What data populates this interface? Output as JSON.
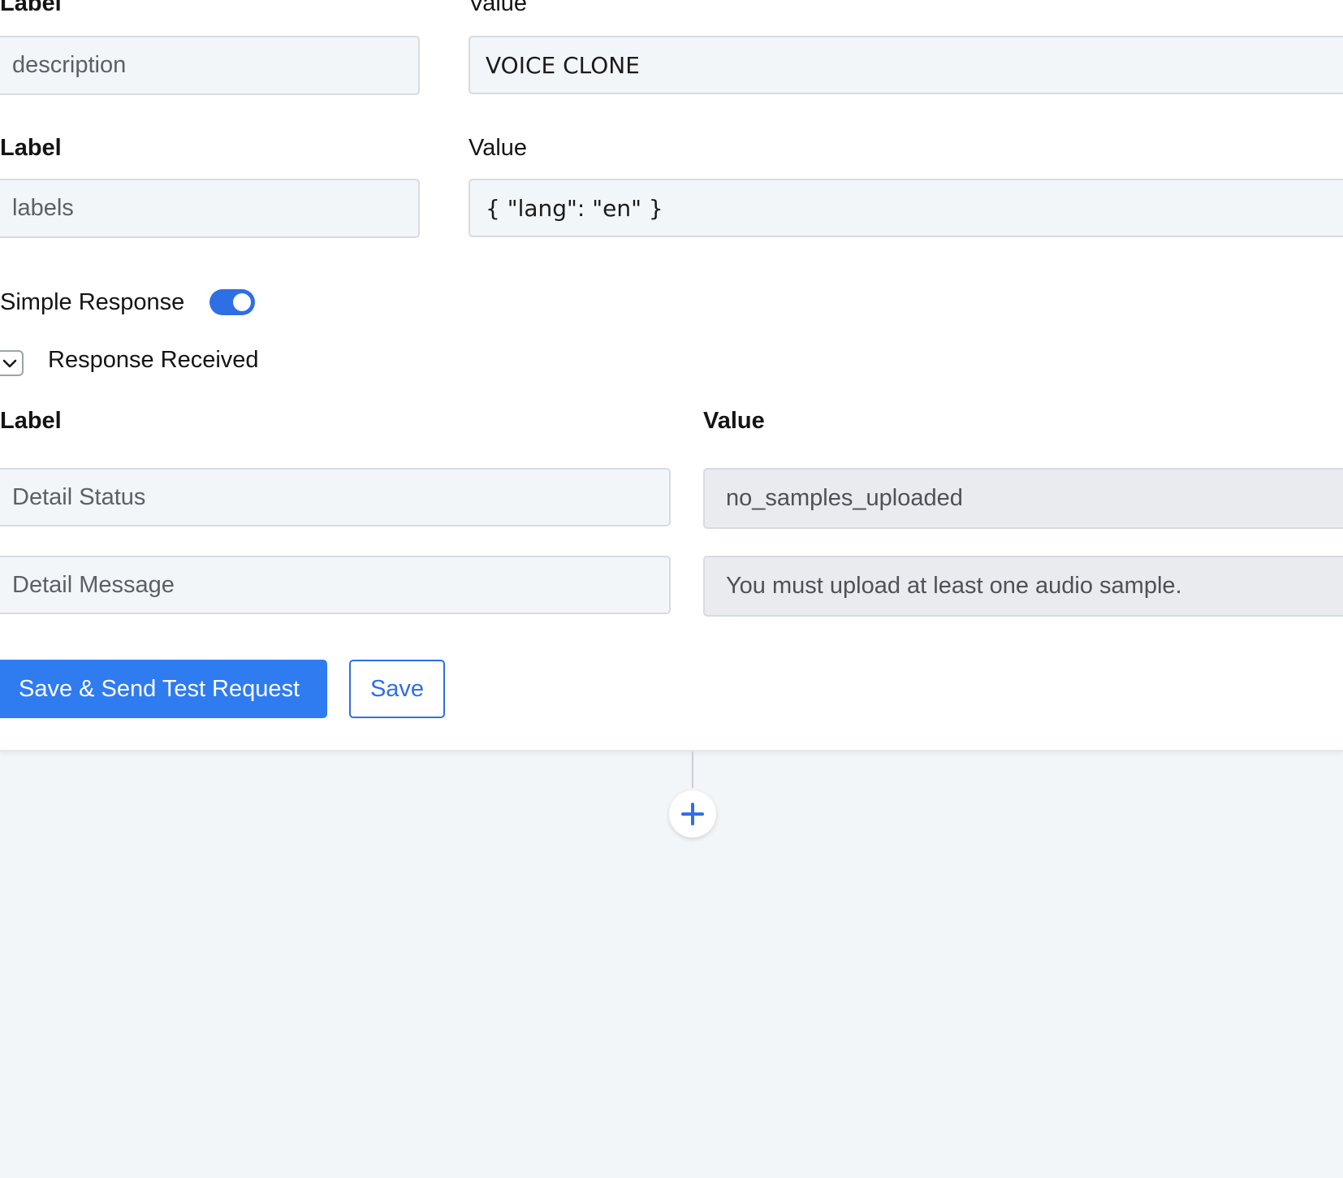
{
  "rows": [
    {
      "label_heading": "Label",
      "value_heading": "Value",
      "label_field": "description",
      "value_field": "VOICE CLONE"
    },
    {
      "label_heading": "Label",
      "value_heading": "Value",
      "label_field": "labels",
      "value_field": "{ \"lang\": \"en\" }"
    }
  ],
  "simple_response": {
    "label": "Simple Response",
    "enabled": true
  },
  "response_received": {
    "label": "Response Received",
    "label_heading": "Label",
    "value_heading": "Value",
    "items": [
      {
        "label": "Detail Status",
        "value": "no_samples_uploaded"
      },
      {
        "label": "Detail Message",
        "value": "You must upload at least one audio sample."
      }
    ]
  },
  "actions": {
    "save_and_send": "Save & Send Test Request",
    "save": "Save"
  },
  "icons": {
    "toggle": "toggle-switch-on",
    "collapse": "chevron-down-icon",
    "add": "plus-icon"
  },
  "colors": {
    "accent": "#2f7bf0",
    "page_background": "#f3f6f9"
  }
}
